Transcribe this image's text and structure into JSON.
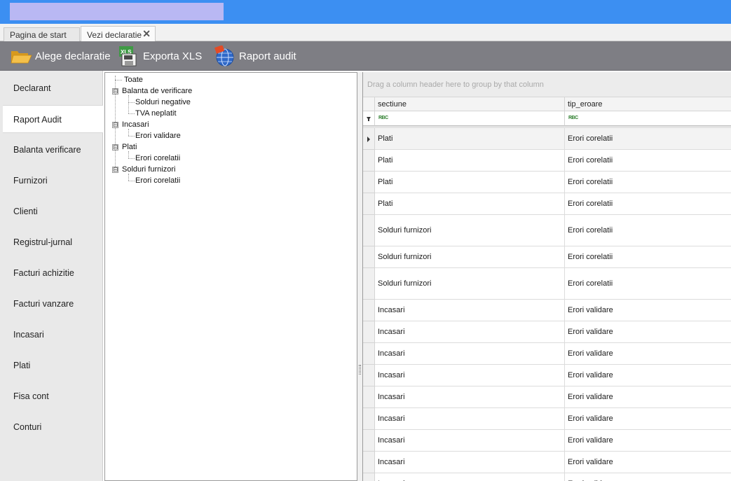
{
  "window": {
    "title": ""
  },
  "tabs": [
    {
      "label": "Pagina de start",
      "active": false
    },
    {
      "label": "Vezi declaratie",
      "active": true,
      "close": "✕"
    }
  ],
  "toolbar": {
    "choose_label": "Alege declaratie",
    "export_label": "Exporta XLS",
    "export_icon_text": "XLS",
    "audit_label": "Raport audit"
  },
  "sidebar": {
    "items": [
      {
        "label": "Declarant",
        "active": false
      },
      {
        "label": "Raport Audit",
        "active": true
      },
      {
        "label": "Balanta verificare",
        "active": false
      },
      {
        "label": "Furnizori",
        "active": false
      },
      {
        "label": "Clienti",
        "active": false
      },
      {
        "label": "Registrul-jurnal",
        "active": false
      },
      {
        "label": "Facturi achizitie",
        "active": false
      },
      {
        "label": "Facturi vanzare",
        "active": false
      },
      {
        "label": "Incasari",
        "active": false
      },
      {
        "label": "Plati",
        "active": false
      },
      {
        "label": "Fisa cont",
        "active": false
      },
      {
        "label": "Conturi",
        "active": false
      }
    ]
  },
  "tree": {
    "expander": "⊟",
    "nodes": [
      {
        "label": "Toate",
        "level": 0,
        "expandable": false
      },
      {
        "label": "Balanta de verificare",
        "level": 0,
        "expandable": true
      },
      {
        "label": "Solduri negative",
        "level": 1,
        "expandable": false
      },
      {
        "label": "TVA neplatit",
        "level": 1,
        "expandable": false
      },
      {
        "label": "Incasari",
        "level": 0,
        "expandable": true
      },
      {
        "label": "Erori validare",
        "level": 1,
        "expandable": false
      },
      {
        "label": "Plati",
        "level": 0,
        "expandable": true
      },
      {
        "label": "Erori corelatii",
        "level": 1,
        "expandable": false
      },
      {
        "label": "Solduri furnizori",
        "level": 0,
        "expandable": true
      },
      {
        "label": "Erori corelatii",
        "level": 1,
        "expandable": false
      }
    ]
  },
  "grid": {
    "group_panel_text": "Drag a column header here to group by that column",
    "filter_icon_text": "RBC",
    "columns": [
      "sectiune",
      "tip_eroare"
    ],
    "rows": [
      {
        "sectiune": "Plati",
        "tip_eroare": "Erori corelatii",
        "selected": true
      },
      {
        "sectiune": "Plati",
        "tip_eroare": "Erori corelatii"
      },
      {
        "sectiune": "Plati",
        "tip_eroare": "Erori corelatii"
      },
      {
        "sectiune": "Plati",
        "tip_eroare": "Erori corelatii"
      },
      {
        "sectiune": "Solduri furnizori",
        "tip_eroare": "Erori corelatii",
        "tall": true
      },
      {
        "sectiune": "Solduri furnizori",
        "tip_eroare": "Erori corelatii"
      },
      {
        "sectiune": "Solduri furnizori",
        "tip_eroare": "Erori corelatii",
        "tall": true
      },
      {
        "sectiune": "Incasari",
        "tip_eroare": "Erori validare"
      },
      {
        "sectiune": "Incasari",
        "tip_eroare": "Erori validare"
      },
      {
        "sectiune": "Incasari",
        "tip_eroare": "Erori validare"
      },
      {
        "sectiune": "Incasari",
        "tip_eroare": "Erori validare"
      },
      {
        "sectiune": "Incasari",
        "tip_eroare": "Erori validare"
      },
      {
        "sectiune": "Incasari",
        "tip_eroare": "Erori validare"
      },
      {
        "sectiune": "Incasari",
        "tip_eroare": "Erori validare"
      },
      {
        "sectiune": "Incasari",
        "tip_eroare": "Erori validare"
      },
      {
        "sectiune": "Incasari",
        "tip_eroare": "Erori validare"
      }
    ]
  }
}
